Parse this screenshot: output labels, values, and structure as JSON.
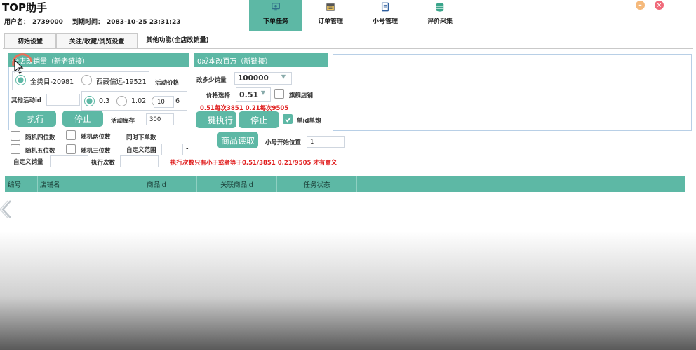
{
  "app": {
    "title": "TOP助手",
    "user_label": "用户名：",
    "user_value": "2739000",
    "expire_label": "到期时间：",
    "expire_value": "2083-10-25 23:31:23"
  },
  "nav": [
    {
      "label": "下单任务",
      "icon": "monitor-icon",
      "active": true
    },
    {
      "label": "订单管理",
      "icon": "calendar-icon",
      "active": false
    },
    {
      "label": "小号管理",
      "icon": "id-card-icon",
      "active": false
    },
    {
      "label": "评价采集",
      "icon": "database-icon",
      "active": false
    }
  ],
  "window_controls": {
    "minimize_color": "#f5b97b",
    "close_color": "#f06a7a"
  },
  "tabs": [
    {
      "label": "初始设置",
      "active": false
    },
    {
      "label": "关注/收藏/浏览设置",
      "active": false
    },
    {
      "label": "其他功能(全店改销量)",
      "active": true
    }
  ],
  "panel1": {
    "header": "全店改销量（新老链接）",
    "radio_all": "全类目-20981",
    "radio_select": "西藏偏远-19521",
    "activity_price_label": "活动价格",
    "other_activity_id_label": "其他活动id",
    "other_activity_id_value": "",
    "price_opt1": "0.3",
    "price_opt2": "1.02",
    "price_opt3_input": "10",
    "price_opt3_suffix": "6",
    "execute_btn": "执行",
    "stop_btn": "停止",
    "activity_stock_label": "活动库存",
    "activity_stock_value": "300"
  },
  "panel2": {
    "header": "0成本改百万（新链接）",
    "change_qty_label": "改多少销量",
    "change_qty_value": "100000",
    "price_select_label": "价格选择",
    "price_select_value": "0.51",
    "flagship_label": "旗舰店铺",
    "hint_red": "0.51每次3851 0.21每次9505",
    "one_click_btn": "一键执行",
    "stop_btn": "停止",
    "single_id_label": "单id单炮"
  },
  "options": {
    "rand4": "随机四位数",
    "rand2": "随机两位数",
    "rand5": "随机五位数",
    "rand3": "随机三位数",
    "concurrent_label": "同时下单数",
    "custom_range_label": "自定义范围",
    "range_sep": "-",
    "custom_sales_label": "自定义销量",
    "exec_count_label": "执行次数",
    "product_read_btn": "商品读取",
    "account_start_label": "小号开始位置",
    "account_start_value": "1",
    "warning_red": "执行次数只有小于或者等于0.51/3851 0.21/9505 才有意义"
  },
  "grid": {
    "columns": [
      "编号",
      "店铺名",
      "商品id",
      "关联商品id",
      "任务状态"
    ]
  },
  "colors": {
    "accent": "#5db8a5",
    "warning": "#e02020"
  }
}
